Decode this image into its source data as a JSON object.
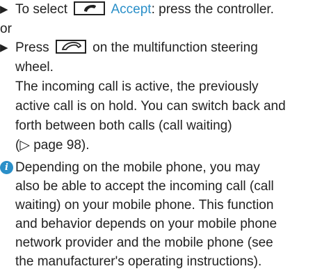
{
  "step1": {
    "prefix": "To select",
    "softkey_label": "Accept",
    "suffix": ": press the controller.",
    "key_icon": "phone-receiver-icon"
  },
  "or_text": "or",
  "step2": {
    "line1_prefix": "Press",
    "line1_suffix": "on the multifunction steering",
    "line2": "wheel.",
    "key_icon": "phone-receiver-icon",
    "result_lines": [
      "The incoming call is active, the previously",
      "active call is on hold. You can switch back and",
      "forth between both calls (call waiting)",
      "(▷ page 98)."
    ]
  },
  "note": {
    "icon": "info-icon",
    "icon_glyph": "i",
    "lines": [
      "Depending on the mobile phone, you may",
      "also be able to accept the incoming call (call",
      "waiting) on your mobile phone. This function",
      "and behavior depends on your mobile phone",
      "network provider and the mobile phone (see",
      "the manufacturer's operating instructions)."
    ]
  },
  "colors": {
    "accent": "#2a8fc8",
    "text": "#222222"
  }
}
